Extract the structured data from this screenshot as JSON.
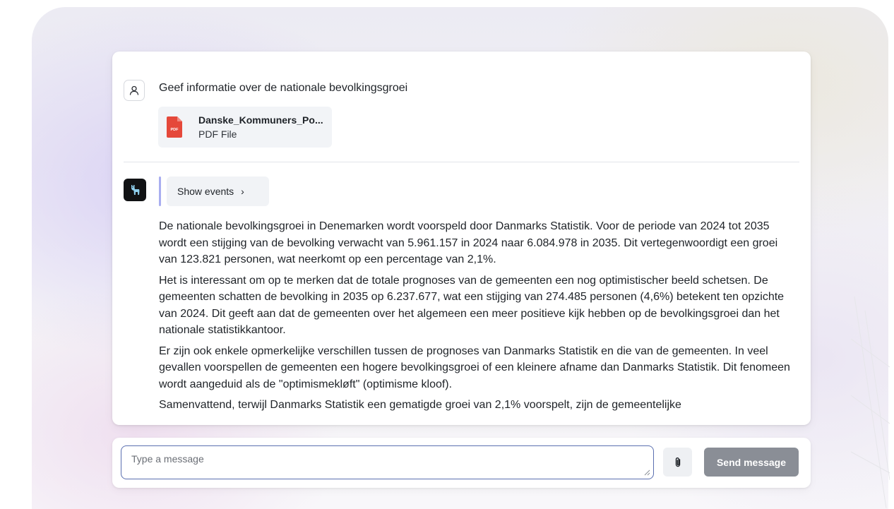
{
  "user_message": {
    "text": "Geef informatie over de nationale bevolkingsgroei",
    "attachment": {
      "name": "Danske_Kommuners_Po...",
      "type": "PDF File",
      "icon_label": "PDF"
    },
    "avatar_icon": "user-icon"
  },
  "assistant_message": {
    "avatar_icon": "llama-icon",
    "show_events_label": "Show events",
    "paragraphs": [
      "De nationale bevolkingsgroei in Denemarken wordt voorspeld door Danmarks Statistik. Voor de periode van 2024 tot 2035 wordt een stijging van de bevolking verwacht van 5.961.157 in 2024 naar 6.084.978 in 2035. Dit vertegenwoordigt een groei van 123.821 personen, wat neerkomt op een percentage van 2,1%.",
      "Het is interessant om op te merken dat de totale prognoses van de gemeenten een nog optimistischer beeld schetsen. De gemeenten schatten de bevolking in 2035 op 6.237.677, wat een stijging van 274.485 personen (4,6%) betekent ten opzichte van 2024. Dit geeft aan dat de gemeenten over het algemeen een meer positieve kijk hebben op de bevolkingsgroei dan het nationale statistikkantoor.",
      "Er zijn ook enkele opmerkelijke verschillen tussen de prognoses van Danmarks Statistik en die van de gemeenten. In veel gevallen voorspellen de gemeenten een hogere bevolkingsgroei of een kleinere afname dan Danmarks Statistik. Dit fenomeen wordt aangeduid als de \"optimismekløft\" (optimisme kloof).",
      "Samenvattend, terwijl Danmarks Statistik een gematigde groei van 2,1% voorspelt, zijn de gemeentelijke"
    ]
  },
  "composer": {
    "placeholder": "Type a message",
    "value": "",
    "attach_icon": "paperclip-icon",
    "send_label": "Send message"
  },
  "colors": {
    "send_button": "#8a8e96",
    "input_border": "#5a6fb0",
    "events_accent": "#a9aef0",
    "pdf_red": "#e5483a"
  }
}
